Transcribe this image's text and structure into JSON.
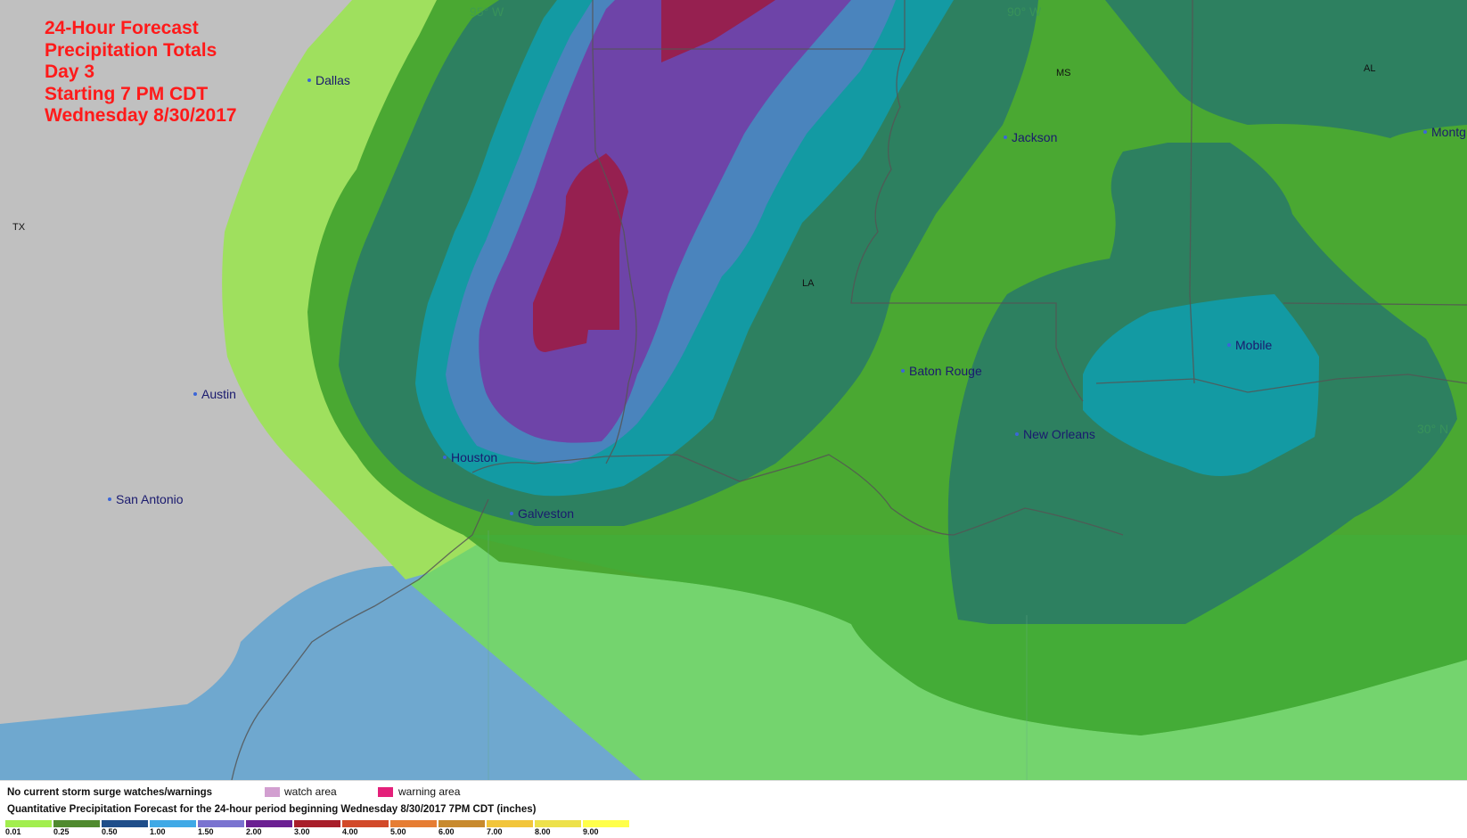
{
  "title": {
    "lines": [
      "24-Hour Forecast",
      "Precipitation Totals",
      "Day 3",
      "Starting 7 PM CDT",
      "Wednesday 8/30/2017"
    ]
  },
  "cities": [
    {
      "name": "Dallas"
    },
    {
      "name": "Austin"
    },
    {
      "name": "San Antonio"
    },
    {
      "name": "Houston"
    },
    {
      "name": "Galveston"
    },
    {
      "name": "Baton Rouge"
    },
    {
      "name": "New Orleans"
    },
    {
      "name": "Jackson"
    },
    {
      "name": "Mobile"
    },
    {
      "name": "Montg"
    }
  ],
  "states": [
    "TX",
    "LA",
    "MS",
    "AL"
  ],
  "grid_labels": [
    "95° W",
    "90° W",
    "30° N"
  ],
  "legend": {
    "status": "No current storm surge watches/warnings",
    "watch_label": "watch area",
    "warning_label": "warning area",
    "watch_color": "#d29fd0",
    "warning_color": "#e4207a",
    "caption": "Quantitative Precipitation Forecast for the 24-hour period beginning Wednesday 8/30/2017 7PM CDT (inches)",
    "scale": [
      {
        "label": "0.01",
        "color": "#a2ee4e"
      },
      {
        "label": "0.25",
        "color": "#4f8a2e"
      },
      {
        "label": "0.50",
        "color": "#1f4e8a"
      },
      {
        "label": "1.00",
        "color": "#3fa9e6"
      },
      {
        "label": "1.50",
        "color": "#7a73d0"
      },
      {
        "label": "2.00",
        "color": "#6b2092"
      },
      {
        "label": "3.00",
        "color": "#a81e2a"
      },
      {
        "label": "4.00",
        "color": "#d24a2a"
      },
      {
        "label": "5.00",
        "color": "#e67d33"
      },
      {
        "label": "6.00",
        "color": "#c88a2e"
      },
      {
        "label": "7.00",
        "color": "#f2c53a"
      },
      {
        "label": "8.00",
        "color": "#ede14a"
      },
      {
        "label": "9.00",
        "color": "#ffff4a"
      }
    ]
  },
  "colors": {
    "land": "#c0c0c0",
    "gulf": "#6fa8cf",
    "band_0_01": "#9fe05e",
    "band_0_25_gulf": "#74d46e",
    "band_0_50": "#4aa832",
    "band_1_00": "#2d8060",
    "band_1_50": "#139aa3",
    "band_2_00": "#4a84bd",
    "band_3_00": "#6e44a8",
    "band_4_00": "#962050"
  }
}
